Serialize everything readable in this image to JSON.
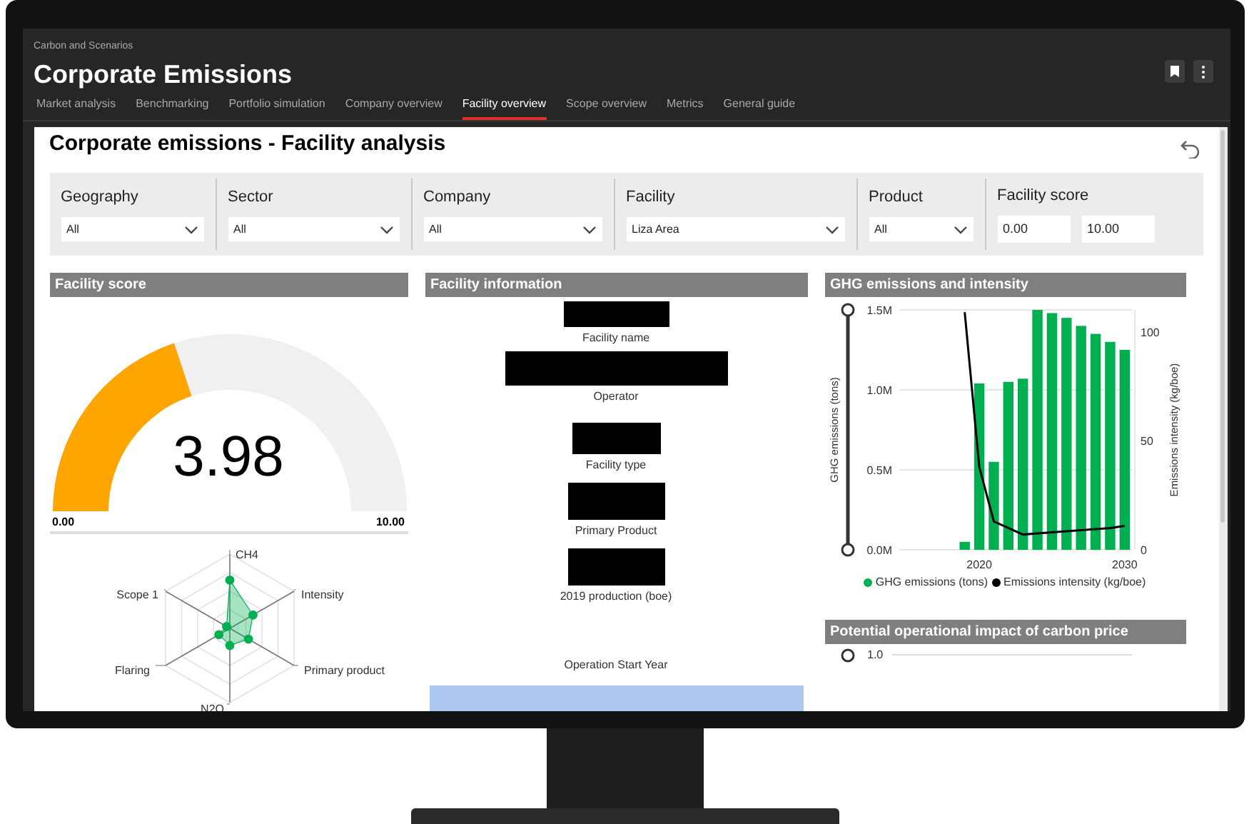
{
  "app": {
    "section": "Carbon and Scenarios",
    "title": "Corporate Emissions"
  },
  "tabs": [
    {
      "label": "Market analysis",
      "selected": false
    },
    {
      "label": "Benchmarking",
      "selected": false
    },
    {
      "label": "Portfolio simulation",
      "selected": false
    },
    {
      "label": "Company overview",
      "selected": false
    },
    {
      "label": "Facility overview",
      "selected": true
    },
    {
      "label": "Scope overview",
      "selected": false
    },
    {
      "label": "Metrics",
      "selected": false
    },
    {
      "label": "General guide",
      "selected": false
    }
  ],
  "page": {
    "title": "Corporate emissions - Facility analysis"
  },
  "filters": [
    {
      "kind": "select",
      "label": "Geography",
      "value": "All"
    },
    {
      "kind": "select",
      "label": "Sector",
      "value": "All"
    },
    {
      "kind": "select",
      "label": "Company",
      "value": "All"
    },
    {
      "kind": "select",
      "label": "Facility",
      "value": "Liza Area"
    },
    {
      "kind": "select",
      "label": "Product",
      "value": "All"
    },
    {
      "kind": "range",
      "label": "Facility score",
      "min": "0.00",
      "max": "10.00"
    }
  ],
  "facility_score": {
    "title": "Facility score",
    "value": "3.98",
    "level": 0.398,
    "min_label": "0.00",
    "max_label": "10.00",
    "radar_labels": [
      "CH4",
      "Intensity",
      "Primary product",
      "N2O",
      "Flaring",
      "Scope 1"
    ]
  },
  "facility_information": {
    "title": "Facility information",
    "fields": [
      {
        "label": "Facility name"
      },
      {
        "label": "Operator"
      },
      {
        "label": "Facility type"
      },
      {
        "label": "Primary Product"
      },
      {
        "label": "2019 production (boe)"
      }
    ],
    "chart_title": "Operation Start Year"
  },
  "ghg_panel": {
    "title": "GHG emissions and intensity",
    "emissions": {
      "chart_data": {
        "type": "bar",
        "ylabel": "GHG emissions (tons)",
        "x": [
          2019,
          2020,
          2021,
          2022,
          2023,
          2024,
          2025,
          2026,
          2027,
          2028,
          2029,
          2030
        ],
        "xlim": [
          2014.5,
          2030.5
        ],
        "series": [
          {
            "name": "GHG emissions (tons)",
            "color": "#00b050",
            "values": [
              0.05,
              1.04,
              0.55,
              1.05,
              1.07,
              1.5,
              1.48,
              1.45,
              1.4,
              1.35,
              1.3,
              1.25
            ]
          }
        ],
        "ylim": [
          0,
          1.5
        ],
        "yticks": [
          {
            "value": 0,
            "label": "0.0M"
          },
          {
            "value": 0.5,
            "label": "0.5M"
          },
          {
            "value": 1,
            "label": "1.0M"
          },
          {
            "value": 1.5,
            "label": "1.5M"
          }
        ],
        "xticks": [
          2020,
          2030
        ]
      }
    },
    "intensity": {
      "chart_data": {
        "type": "line",
        "ylabel": "Emissions intensity (kg/boe)",
        "x": [
          2019,
          2020,
          2021,
          2022,
          2023,
          2024,
          2025,
          2026,
          2027,
          2028,
          2029,
          2030
        ],
        "xlim": [
          2014.5,
          2030.5
        ],
        "series": [
          {
            "name": "Emissions intensity (kg/boe)",
            "color": "#000000",
            "values": [
              109,
              38,
              13,
              10,
              7,
              7.5,
              8,
              8.5,
              9,
              9.5,
              10,
              11
            ]
          }
        ],
        "ylim": [
          0,
          110
        ],
        "yticks": [
          0,
          50,
          100
        ]
      }
    }
  },
  "carbon_panel": {
    "title": "Potential operational impact of carbon price",
    "tick": "1.0"
  }
}
